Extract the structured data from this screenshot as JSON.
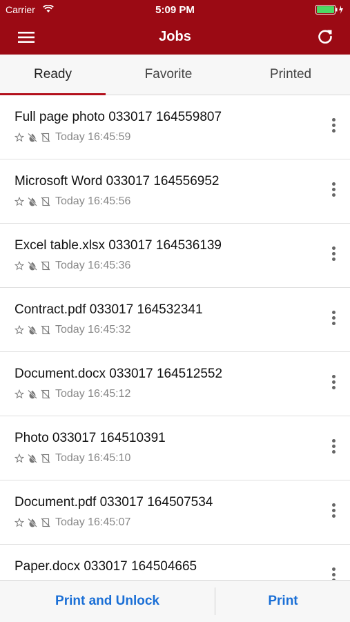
{
  "status_bar": {
    "carrier": "Carrier",
    "time": "5:09 PM"
  },
  "nav": {
    "title": "Jobs",
    "menu_icon": "hamburger-menu-icon",
    "refresh_icon": "refresh-icon"
  },
  "tabs": [
    {
      "label": "Ready",
      "active": true
    },
    {
      "label": "Favorite",
      "active": false
    },
    {
      "label": "Printed",
      "active": false
    }
  ],
  "jobs": [
    {
      "name": "Full page photo 033017 164559807",
      "time": "Today 16:45:59"
    },
    {
      "name": "Microsoft Word 033017 164556952",
      "time": "Today 16:45:56"
    },
    {
      "name": "Excel table.xlsx 033017 164536139",
      "time": "Today 16:45:36"
    },
    {
      "name": "Contract.pdf 033017 164532341",
      "time": "Today 16:45:32"
    },
    {
      "name": "Document.docx 033017 164512552",
      "time": "Today 16:45:12"
    },
    {
      "name": "Photo 033017 164510391",
      "time": "Today 16:45:10"
    },
    {
      "name": "Document.pdf 033017 164507534",
      "time": "Today 16:45:07"
    },
    {
      "name": "Paper.docx 033017 164504665",
      "time": ""
    }
  ],
  "row_icons": [
    "star-outline-icon",
    "no-color-icon",
    "no-duplex-icon"
  ],
  "actions": {
    "print_unlock_label": "Print and Unlock",
    "print_label": "Print"
  },
  "colors": {
    "brand": "#9b0a14",
    "tab_indicator": "#b3101c",
    "action": "#1a6fd6"
  }
}
